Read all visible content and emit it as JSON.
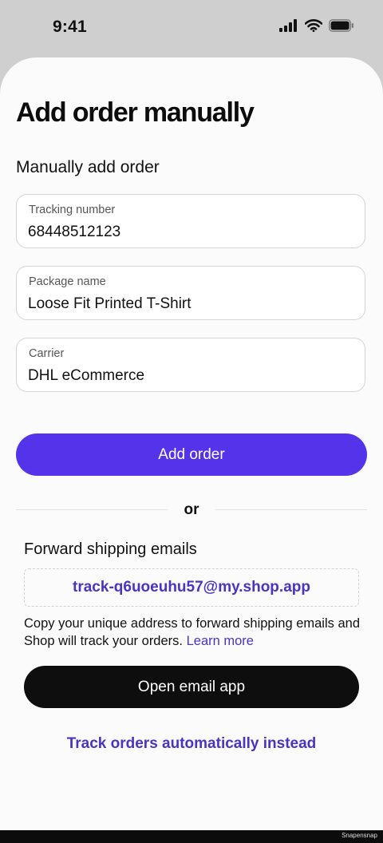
{
  "status_bar": {
    "time": "9:41",
    "icons": [
      "cellular-signal-icon",
      "wifi-icon",
      "battery-icon"
    ]
  },
  "page": {
    "title": "Add order manually",
    "section_title": "Manually add order"
  },
  "form": {
    "fields": [
      {
        "label": "Tracking number",
        "value": "68448512123"
      },
      {
        "label": "Package name",
        "value": "Loose Fit Printed T-Shirt"
      },
      {
        "label": "Carrier",
        "value": "DHL eCommerce"
      }
    ],
    "submit_label": "Add order"
  },
  "divider": {
    "text": "or"
  },
  "forward": {
    "title": "Forward shipping emails",
    "email": "track-q6uoeuhu57@my.shop.app",
    "helper_text": "Copy your unique address to forward shipping emails and Shop will track your orders.",
    "learn_more": "Learn more",
    "open_email_label": "Open email app",
    "track_auto_label": "Track orders automatically instead"
  },
  "colors": {
    "primary": "#5433eb",
    "link": "#4b33c4",
    "dark_button": "#0e0e0e",
    "backdrop": "#cfcfcf",
    "sheet": "#fbfbfb"
  },
  "watermark": "Snapensnap"
}
